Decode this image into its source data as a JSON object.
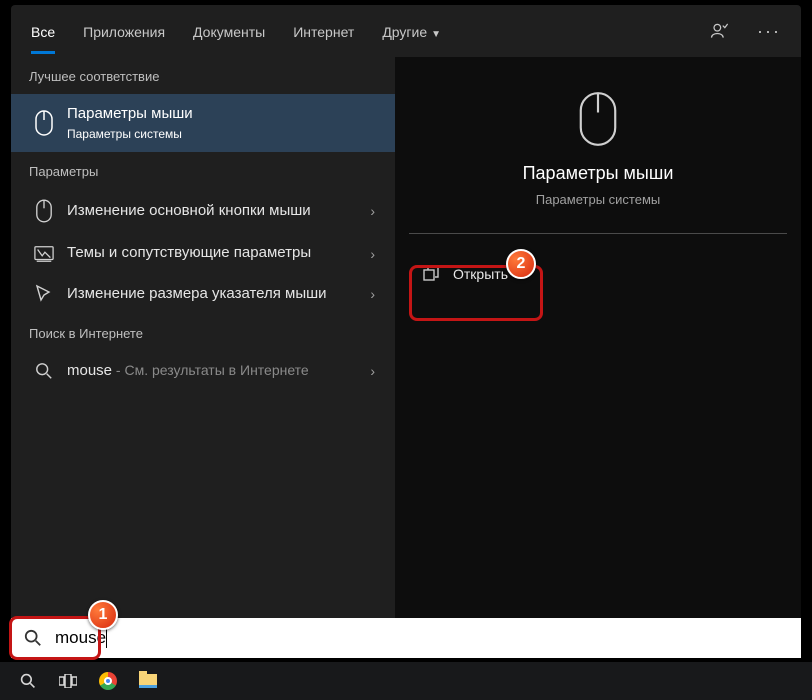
{
  "tabs": {
    "all": "Все",
    "apps": "Приложения",
    "docs": "Документы",
    "web": "Интернет",
    "more": "Другие"
  },
  "sec": {
    "best": "Лучшее соответствие",
    "params": "Параметры",
    "websearch": "Поиск в Интернете"
  },
  "best": {
    "title": "Параметры мыши",
    "sub": "Параметры системы"
  },
  "p1": "Изменение основной кнопки мыши",
  "p2": "Темы и сопутствующие параметры",
  "p3": "Изменение размера указателя мыши",
  "web": {
    "term": "mouse",
    "after": " - См. результаты в Интернете"
  },
  "right": {
    "title": "Параметры мыши",
    "sub": "Параметры системы",
    "open": "Открыть"
  },
  "search": {
    "value": "mouse"
  },
  "badge1": "1",
  "badge2": "2"
}
